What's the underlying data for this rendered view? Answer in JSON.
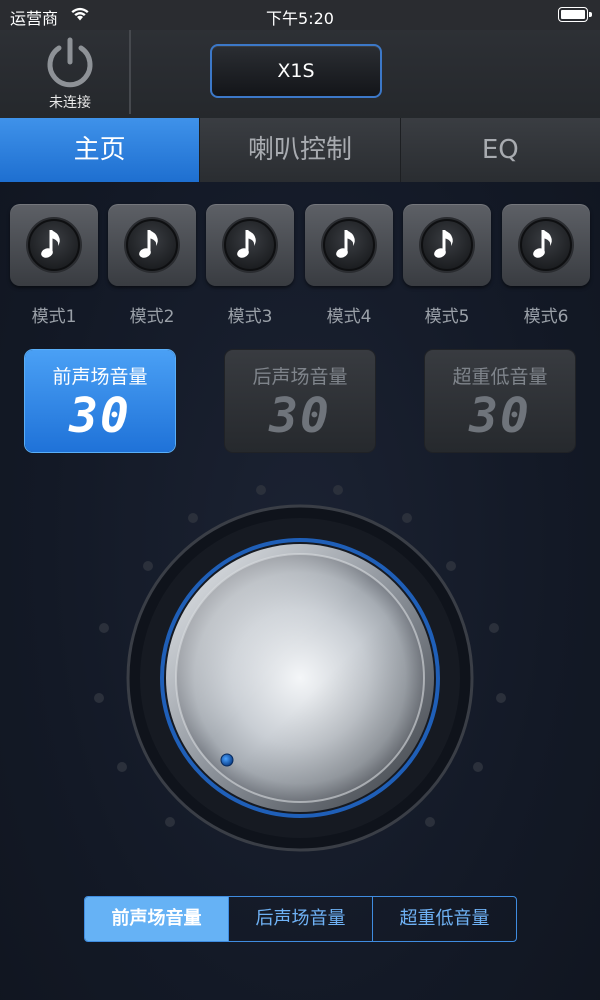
{
  "status_bar": {
    "carrier": "运营商",
    "time": "下午5:20"
  },
  "header": {
    "power_label": "未连接",
    "device_name": "X1S"
  },
  "tabs": [
    {
      "label": "主页",
      "active": true
    },
    {
      "label": "喇叭控制",
      "active": false
    },
    {
      "label": "EQ",
      "active": false
    }
  ],
  "modes": [
    {
      "label": "模式1"
    },
    {
      "label": "模式2"
    },
    {
      "label": "模式3"
    },
    {
      "label": "模式4"
    },
    {
      "label": "模式5"
    },
    {
      "label": "模式6"
    }
  ],
  "volume_cards": [
    {
      "title": "前声场音量",
      "value": "30",
      "active": true
    },
    {
      "title": "后声场音量",
      "value": "30",
      "active": false
    },
    {
      "title": "超重低音量",
      "value": "30",
      "active": false
    }
  ],
  "segments": [
    {
      "label": "前声场音量",
      "active": true
    },
    {
      "label": "后声场音量",
      "active": false
    },
    {
      "label": "超重低音量",
      "active": false
    }
  ],
  "colors": {
    "accent": "#2f84e6",
    "active_segment": "#66b2f5",
    "ring": "#1f5fb8"
  }
}
